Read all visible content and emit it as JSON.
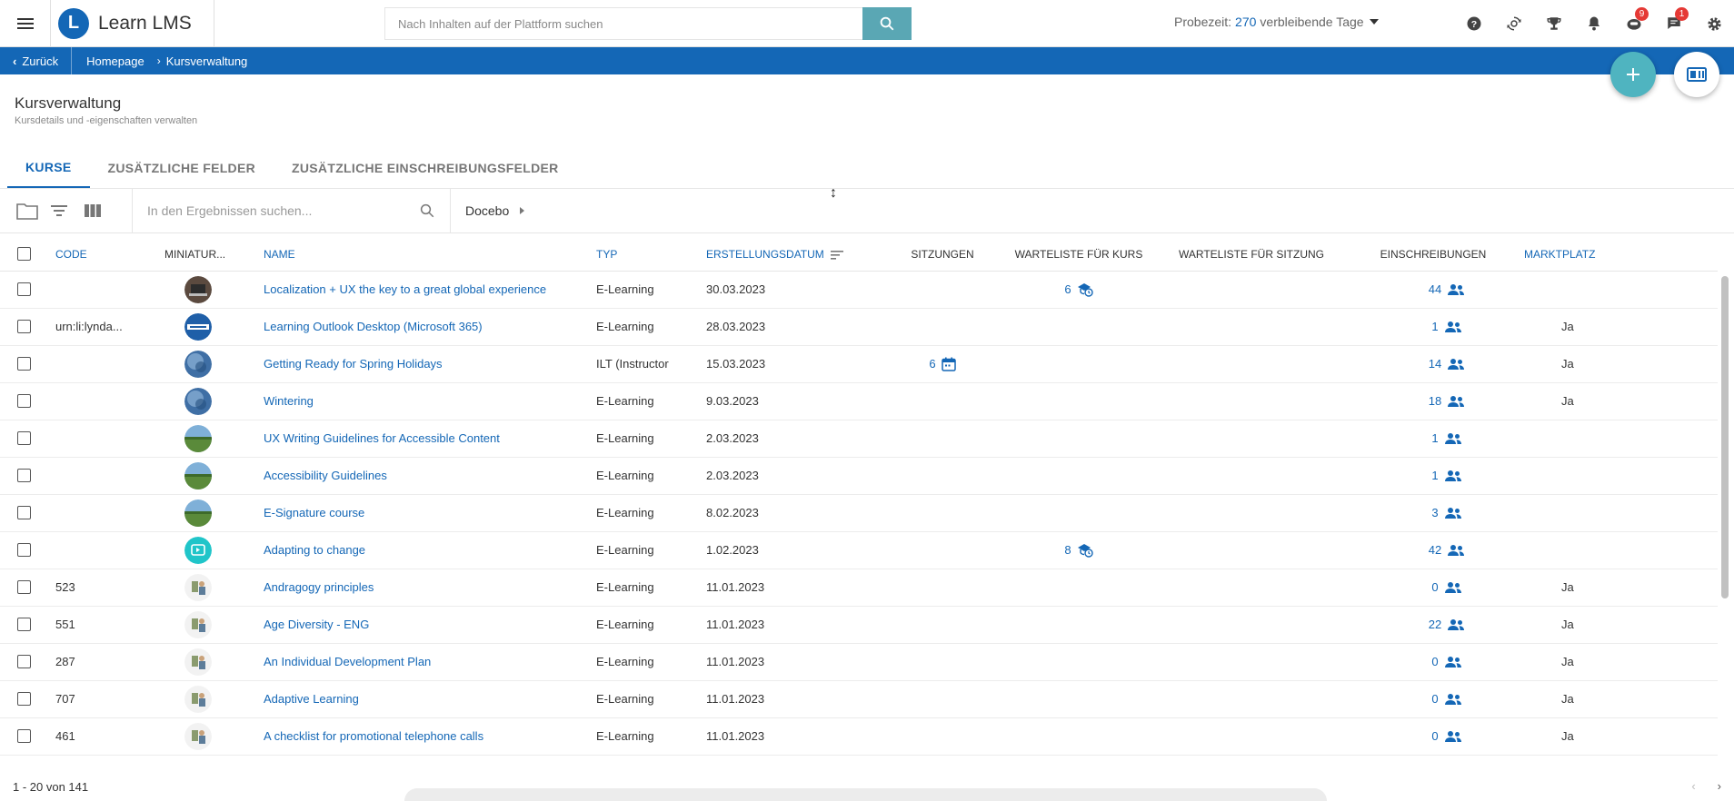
{
  "app": {
    "name": "Learn LMS",
    "logo_letter": "L"
  },
  "search": {
    "placeholder": "Nach Inhalten auf der Plattform suchen"
  },
  "trial": {
    "prefix": "Probezeit:",
    "days": "270",
    "suffix": "verbleibende Tage"
  },
  "header_icons": [
    {
      "name": "help-icon"
    },
    {
      "name": "sync-icon"
    },
    {
      "name": "trophy-icon"
    },
    {
      "name": "bell-icon"
    },
    {
      "name": "courses-icon",
      "badge": "9"
    },
    {
      "name": "chat-icon",
      "badge": "1"
    },
    {
      "name": "settings-icon"
    }
  ],
  "breadcrumb": {
    "back": "Zurück",
    "items": [
      "Homepage",
      "Kursverwaltung"
    ]
  },
  "page": {
    "title": "Kursverwaltung",
    "subtitle": "Kursdetails und -eigenschaften verwalten"
  },
  "tabs": [
    "KURSE",
    "ZUSÄTZLICHE FELDER",
    "ZUSÄTZLICHE EINSCHREIBUNGSFELDER"
  ],
  "toolbar": {
    "search_placeholder": "In den Ergebnissen suchen...",
    "branch": "Docebo"
  },
  "columns": {
    "code": "CODE",
    "thumb": "MINIATUR...",
    "name": "NAME",
    "type": "TYP",
    "created": "ERSTELLUNGSDATUM",
    "sessions": "SITZUNGEN",
    "waitlist_course": "WARTELISTE FÜR KURS",
    "waitlist_session": "WARTELISTE FÜR SITZUNG",
    "enrollments": "EINSCHREIBUNGEN",
    "marketplace": "MARKTPLATZ"
  },
  "rows": [
    {
      "code": "",
      "thumb": "laptop",
      "name": "Localization + UX the key to a great global experience",
      "type": "E-Learning",
      "date": "30.03.2023",
      "sessions": "",
      "waitlist": "6",
      "enrollments": "44",
      "market": ""
    },
    {
      "code": "urn:li:lynda...",
      "thumb": "outlook",
      "name": "Learning Outlook Desktop (Microsoft 365)",
      "type": "E-Learning",
      "date": "28.03.2023",
      "sessions": "",
      "waitlist": "",
      "enrollments": "1",
      "market": "Ja"
    },
    {
      "code": "",
      "thumb": "globe",
      "name": "Getting Ready for Spring Holidays",
      "type": "ILT (Instructor",
      "date": "15.03.2023",
      "sessions": "6",
      "waitlist": "",
      "enrollments": "14",
      "market": "Ja"
    },
    {
      "code": "",
      "thumb": "globe",
      "name": "Wintering",
      "type": "E-Learning",
      "date": "9.03.2023",
      "sessions": "",
      "waitlist": "",
      "enrollments": "18",
      "market": "Ja"
    },
    {
      "code": "",
      "thumb": "landscape",
      "name": "UX Writing Guidelines for Accessible Content",
      "type": "E-Learning",
      "date": "2.03.2023",
      "sessions": "",
      "waitlist": "",
      "enrollments": "1",
      "market": ""
    },
    {
      "code": "",
      "thumb": "landscape",
      "name": "Accessibility Guidelines",
      "type": "E-Learning",
      "date": "2.03.2023",
      "sessions": "",
      "waitlist": "",
      "enrollments": "1",
      "market": ""
    },
    {
      "code": "",
      "thumb": "landscape",
      "name": "E-Signature course",
      "type": "E-Learning",
      "date": "8.02.2023",
      "sessions": "",
      "waitlist": "",
      "enrollments": "3",
      "market": ""
    },
    {
      "code": "",
      "thumb": "video",
      "name": "Adapting to change",
      "type": "E-Learning",
      "date": "1.02.2023",
      "sessions": "",
      "waitlist": "8",
      "enrollments": "42",
      "market": ""
    },
    {
      "code": "523",
      "thumb": "illustration",
      "name": "Andragogy principles",
      "type": "E-Learning",
      "date": "11.01.2023",
      "sessions": "",
      "waitlist": "",
      "enrollments": "0",
      "market": "Ja"
    },
    {
      "code": "551",
      "thumb": "illustration",
      "name": "Age Diversity - ENG",
      "type": "E-Learning",
      "date": "11.01.2023",
      "sessions": "",
      "waitlist": "",
      "enrollments": "22",
      "market": "Ja"
    },
    {
      "code": "287",
      "thumb": "illustration",
      "name": "An Individual Development Plan",
      "type": "E-Learning",
      "date": "11.01.2023",
      "sessions": "",
      "waitlist": "",
      "enrollments": "0",
      "market": "Ja"
    },
    {
      "code": "707",
      "thumb": "illustration",
      "name": "Adaptive Learning",
      "type": "E-Learning",
      "date": "11.01.2023",
      "sessions": "",
      "waitlist": "",
      "enrollments": "0",
      "market": "Ja"
    },
    {
      "code": "461",
      "thumb": "illustration",
      "name": "A checklist for promotional telephone calls",
      "type": "E-Learning",
      "date": "11.01.2023",
      "sessions": "",
      "waitlist": "",
      "enrollments": "0",
      "market": "Ja"
    }
  ],
  "footer": {
    "pagination": "1 - 20 von 141"
  },
  "colors": {
    "primary": "#1467b6",
    "accent": "#4fb4c0",
    "badge": "#e53935"
  }
}
